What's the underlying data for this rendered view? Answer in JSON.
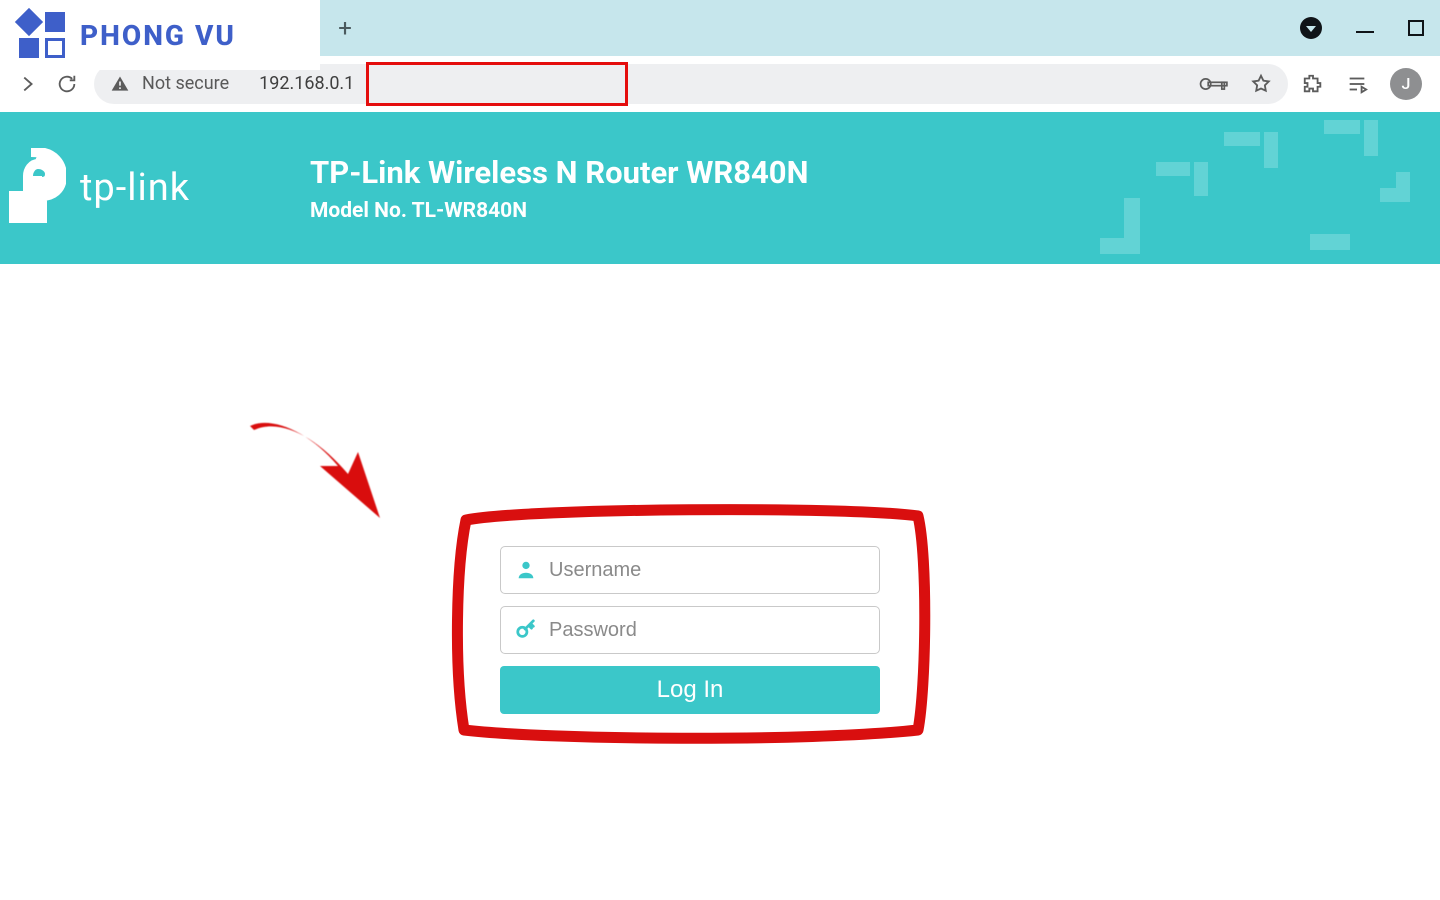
{
  "overlay": {
    "brand_text": "PHONG VU"
  },
  "browser": {
    "newtab_tooltip": "+",
    "security_label": "Not secure",
    "url": "192.168.0.1",
    "avatar_initial": "J"
  },
  "router": {
    "brand": "tp-link",
    "title": "TP-Link Wireless N Router WR840N",
    "model_line": "Model No. TL-WR840N"
  },
  "login": {
    "username_placeholder": "Username",
    "password_placeholder": "Password",
    "button_label": "Log In"
  },
  "colors": {
    "accent_teal": "#3bc7c9",
    "annotation_red": "#d90f0f",
    "overlay_blue": "#3e5fc9"
  }
}
